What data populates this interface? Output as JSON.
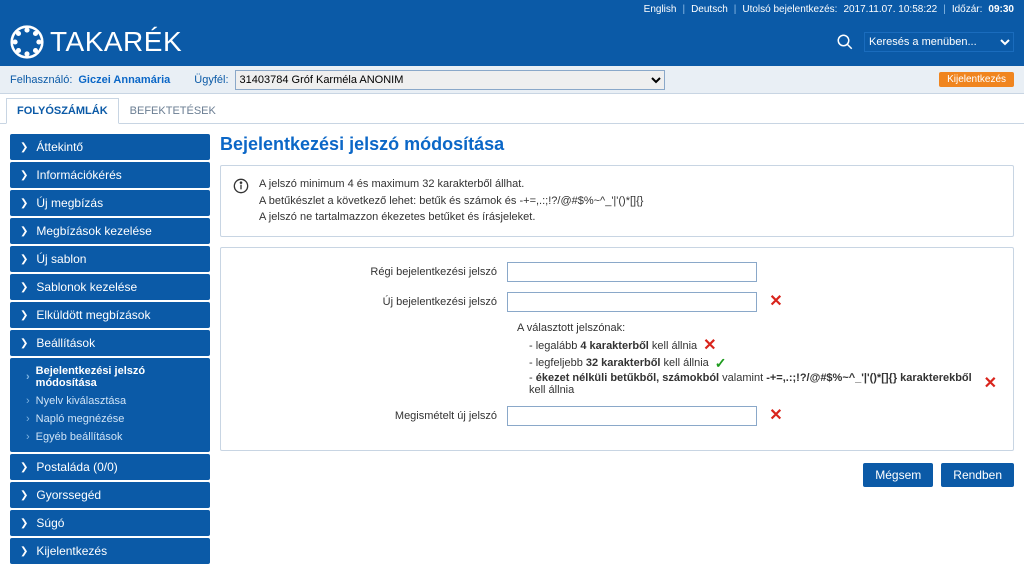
{
  "topbar": {
    "english": "English",
    "deutsch": "Deutsch",
    "last_login_label": "Utolsó bejelentkezés:",
    "last_login_value": "2017.11.07. 10:58:22",
    "timeout_label": "Időzár:",
    "timeout_value": "09:30"
  },
  "logo": {
    "text": "TAKARÉK"
  },
  "menu_search": {
    "placeholder": "Keresés a menüben..."
  },
  "userbar": {
    "user_label": "Felhasználó:",
    "user_name": "Giczei Annamária",
    "client_label": "Ügyfél:",
    "client_selected": "31403784 Gróf Karméla ANONIM",
    "logout": "Kijelentkezés"
  },
  "tabs": [
    {
      "label": "FOLYÓSZÁMLÁK",
      "active": true
    },
    {
      "label": "BEFEKTETÉSEK",
      "active": false
    }
  ],
  "sidebar": [
    {
      "label": "Áttekintő",
      "chev": "right"
    },
    {
      "label": "Információkérés",
      "chev": "right"
    },
    {
      "label": "Új megbízás",
      "chev": "right"
    },
    {
      "label": "Megbízások kezelése",
      "chev": "right"
    },
    {
      "label": "Új sablon",
      "chev": "right"
    },
    {
      "label": "Sablonok kezelése",
      "chev": "right"
    },
    {
      "label": "Elküldött megbízások",
      "chev": "right"
    },
    {
      "label": "Beállítások",
      "chev": "down",
      "expanded": true,
      "children": [
        {
          "label": "Bejelentkezési jelszó módosítása",
          "active": true
        },
        {
          "label": "Nyelv kiválasztása"
        },
        {
          "label": "Napló megnézése"
        },
        {
          "label": "Egyéb beállítások"
        }
      ]
    },
    {
      "label": "Postaláda (0/0)",
      "chev": "right"
    },
    {
      "label": "Gyorssegéd",
      "chev": "right"
    },
    {
      "label": "Súgó",
      "chev": "right"
    },
    {
      "label": "Kijelentkezés",
      "chev": "right"
    }
  ],
  "page": {
    "title": "Bejelentkezési jelszó módosítása",
    "info": {
      "line1": "A jelszó minimum 4 és maximum 32 karakterből állhat.",
      "line2_a": "A betűkészlet a következő lehet: betűk és számok és ",
      "line2_chars": "-+=,.:;!?/@#$%~^_'|'()*[]{}",
      "line3": "A jelszó ne tartalmazzon ékezetes betűket és írásjeleket."
    },
    "form": {
      "old_label": "Régi bejelentkezési jelszó",
      "new_label": "Új bejelentkezési jelszó",
      "repeat_label": "Megismételt új jelszó",
      "validation_title": "A választott jelszónak:",
      "rule1_pre": "- legalább ",
      "rule1_bold": "4 karakterből",
      "rule1_post": " kell állnia",
      "rule1_status": "invalid",
      "rule2_pre": "- legfeljebb ",
      "rule2_bold": "32 karakterből",
      "rule2_post": " kell állnia",
      "rule2_status": "valid",
      "rule3_pre": "- ",
      "rule3_bold": "ékezet nélküli betűkből, számokból",
      "rule3_mid": " valamint ",
      "rule3_chars": "-+=,.:;!?/@#$%~^_'|'()*[]{} karakterekből",
      "rule3_post": " kell állnia",
      "rule3_status": "invalid",
      "cancel": "Mégsem",
      "ok": "Rendben"
    }
  }
}
